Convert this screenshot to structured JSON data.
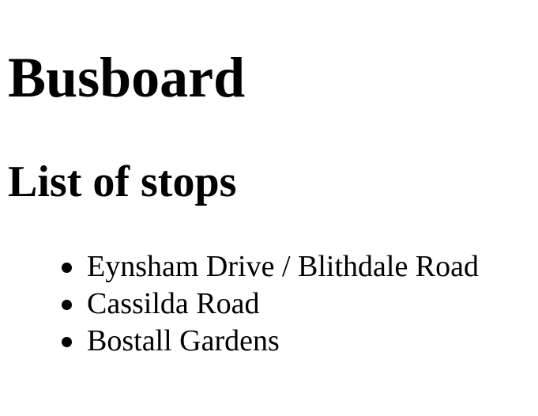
{
  "header": {
    "title": "Busboard"
  },
  "main": {
    "section_title": "List of stops",
    "stops": [
      {
        "name": "Eynsham Drive / Blithdale Road"
      },
      {
        "name": "Cassilda Road"
      },
      {
        "name": "Bostall Gardens"
      }
    ]
  }
}
